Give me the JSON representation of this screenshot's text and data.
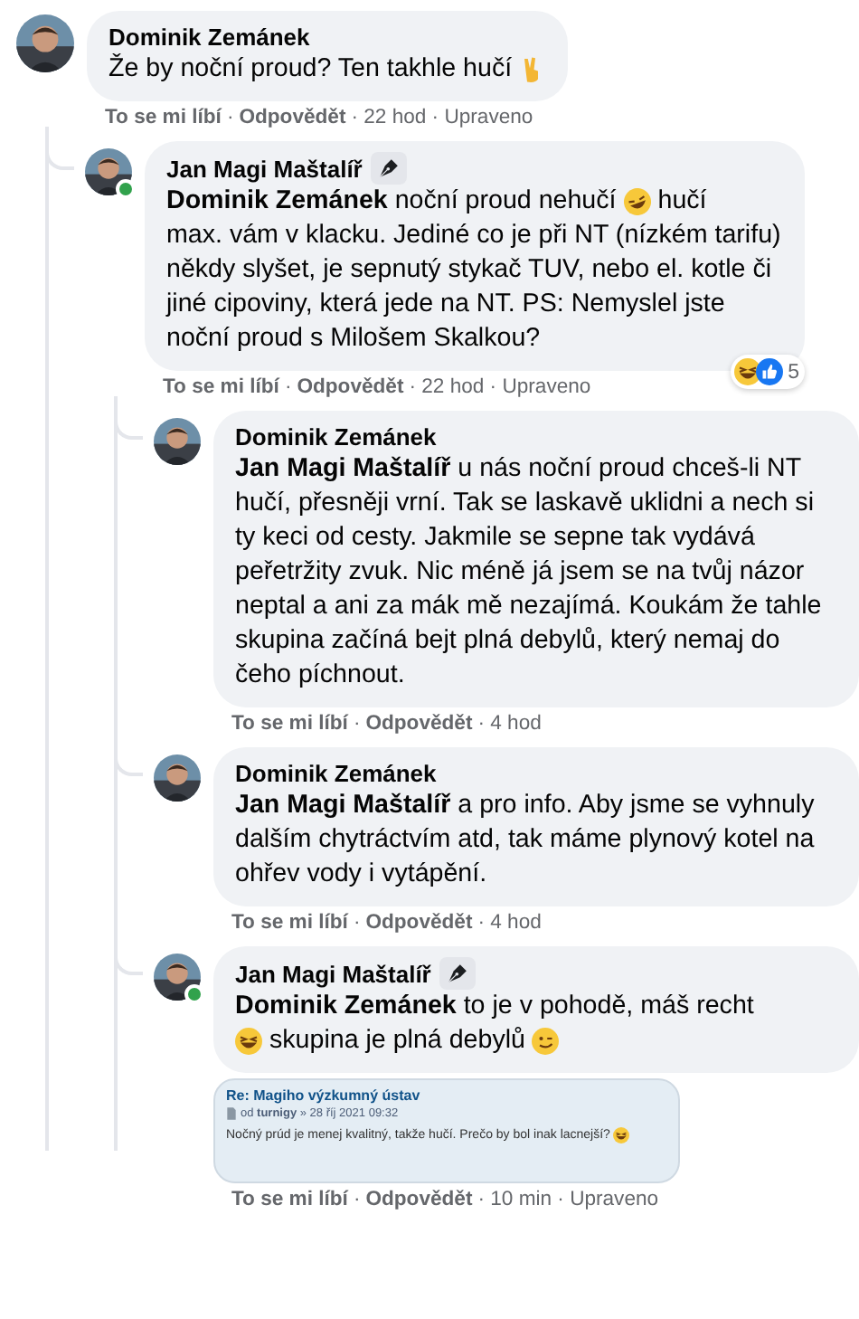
{
  "comments": [
    {
      "author": "Dominik Zemánek",
      "badge": false,
      "online": false,
      "body": [
        {
          "kind": "text",
          "text": "Že by noční proud? Ten takhle hučí"
        },
        {
          "kind": "victory-emoji"
        }
      ],
      "footer": {
        "like": "To se mi líbí",
        "sep": "·",
        "reply": "Odpovědět",
        "meta": "· 22 hod · Upraveno"
      },
      "children": [
        {
          "author": "Jan Magi Maštalíř",
          "badge": true,
          "online": true,
          "body": [
            {
              "kind": "text",
              "text": "**Dominik Zemánek** noční proud nehučí"
            },
            {
              "kind": "rofl-emoji"
            },
            {
              "kind": "text",
              "text": "hučí"
            },
            {
              "kind": "text",
              "text": "max. vám v klacku. Jediné co je při NT (nízkém tarifu) někdy slyšet, je sepnutý stykač TUV, nebo el. kotle či jiné cipoviny, která jede na NT. PS: Nemyslel jste noční proud s Milošem Skalkou?"
            }
          ],
          "reactions": {
            "icons": [
              {
                "kind": "laugh-emoji"
              },
              {
                "kind": "like-emoji"
              }
            ],
            "count": "5"
          },
          "footer": {
            "like": "To se mi líbí",
            "sep": "·",
            "reply": "Odpovědět",
            "meta": "· 22 hod · Upraveno"
          },
          "children": [
            {
              "author": "Dominik Zemánek",
              "badge": false,
              "online": false,
              "body": [
                {
                  "kind": "text",
                  "text": "**Jan Magi Maštalíř** u nás noční proud chceš-li NT hučí, přesněji vrní. Tak se laskavě uklidni a nech si ty keci od cesty. Jakmile se sepne tak vydává peřetržity zvuk. Nic méně já jsem se na tvůj názor neptal a ani za mák mě nezajímá. Koukám že tahle skupina začíná bejt plná debylů, který nemaj do čeho píchnout."
                }
              ],
              "footer": {
                "like": "To se mi líbí",
                "sep": "·",
                "reply": "Odpovědět",
                "meta": "· 4 hod"
              }
            },
            {
              "author": "Dominik Zemánek",
              "badge": false,
              "online": false,
              "body": [
                {
                  "kind": "text",
                  "text": "**Jan Magi Maštalíř** a pro info. Aby jsme se vyhnuly dalším chytráctvím atd, tak máme plynový kotel na ohřev vody i vytápění."
                }
              ],
              "footer": {
                "like": "To se mi líbí",
                "sep": "·",
                "reply": "Odpovědět",
                "meta": "· 4 hod"
              }
            },
            {
              "author": "Jan Magi Maštalíř",
              "badge": true,
              "online": true,
              "body": [
                {
                  "kind": "text",
                  "text": "**Dominik Zemánek** to je v pohodě, máš recht"
                },
                {
                  "kind": "break"
                },
                {
                  "kind": "laugh-emoji"
                },
                {
                  "kind": "text",
                  "text": "skupina je plná debylů"
                },
                {
                  "kind": "wink-emoji"
                }
              ],
              "attachment": {
                "title": "Re: Magiho výzkumný ústav",
                "meta": "od **turnigy** » 28 říj 2021 09:32",
                "body": [
                  {
                    "kind": "text",
                    "text": "Nočný prúd je menej kvalitný, takže hučí. Prečo by bol inak lacnejší?"
                  },
                  {
                    "kind": "laugh-emoji"
                  }
                ]
              },
              "footer": {
                "like": "To se mi líbí",
                "sep": "·",
                "reply": "Odpovědět",
                "meta": "· 10 min · Upraveno"
              }
            }
          ]
        }
      ]
    }
  ]
}
